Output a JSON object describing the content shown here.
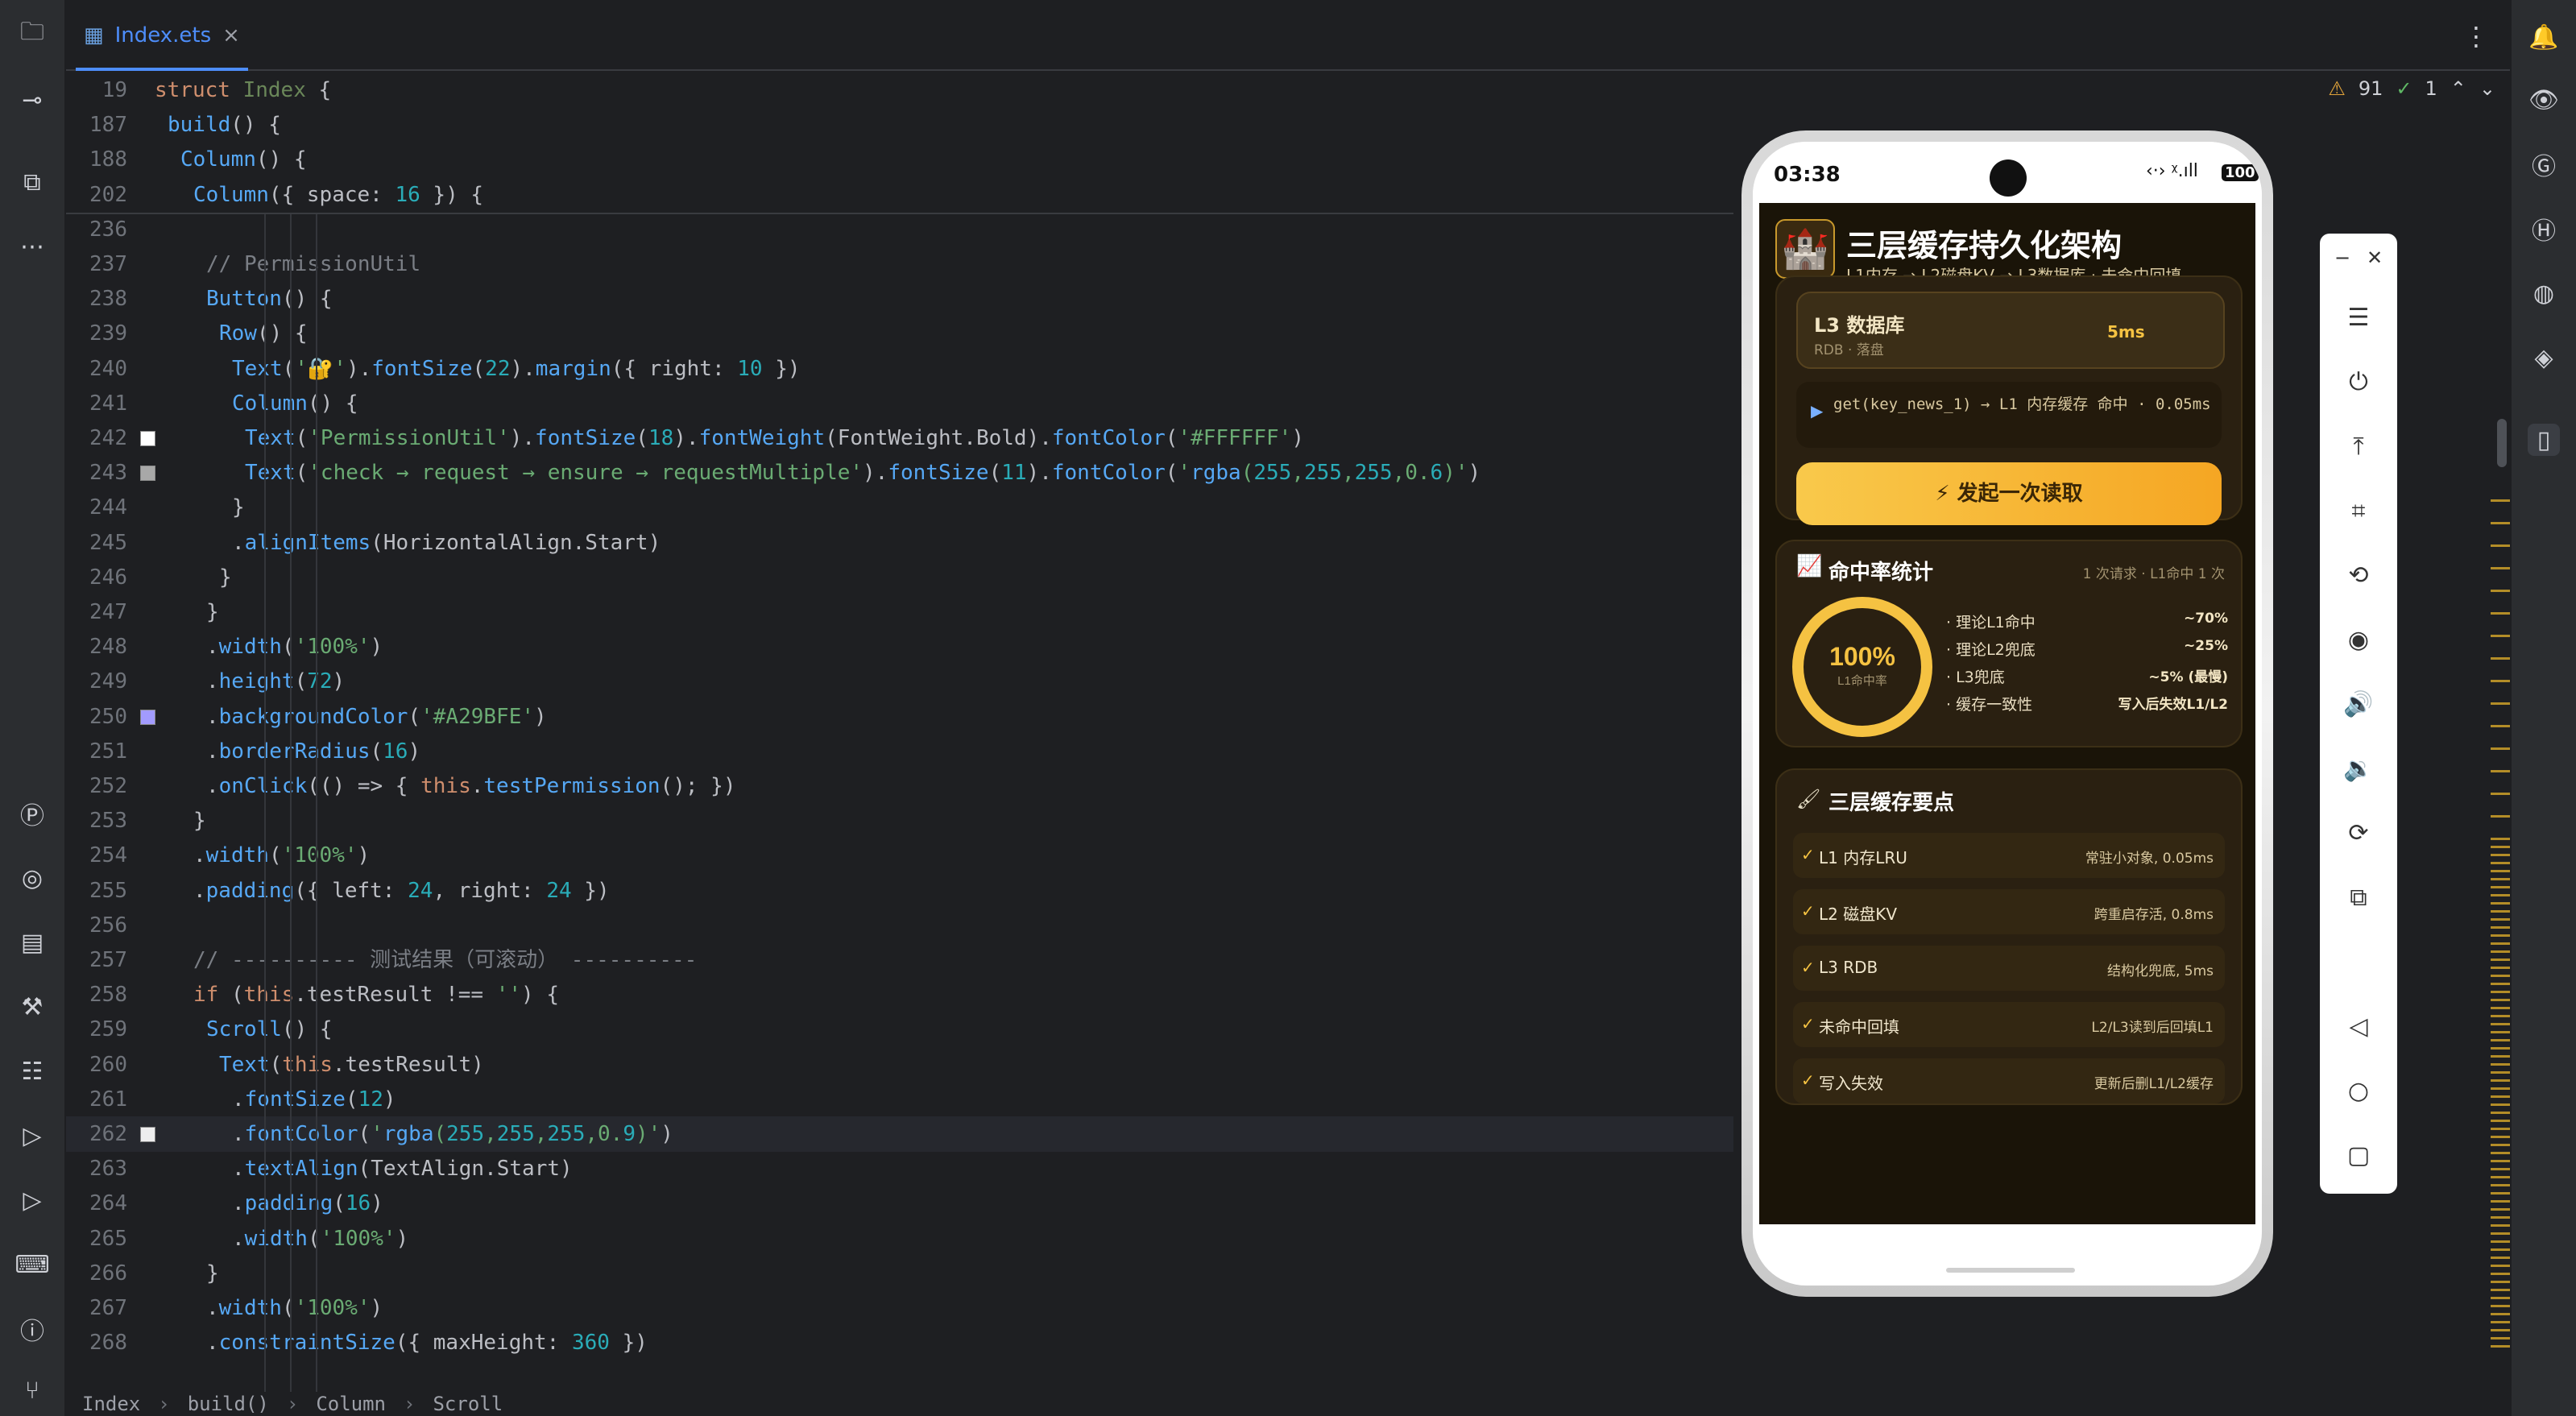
{
  "tab": {
    "filename": "Index.ets",
    "close": "×",
    "more": "⋮"
  },
  "inspect": {
    "warn_icon": "⚠",
    "warnings": "91",
    "ok_icon": "✓",
    "ok_count": "1",
    "up": "⌃",
    "down": "⌄"
  },
  "lines": [
    {
      "n": "19",
      "t": "struct Index {"
    },
    {
      "n": "187",
      "t": "build() {"
    },
    {
      "n": "188",
      "t": "Column() {"
    },
    {
      "n": "202",
      "t": "Column({ space: 16 }) {"
    },
    {
      "n": "236",
      "t": ""
    },
    {
      "n": "237",
      "t": "// PermissionUtil"
    },
    {
      "n": "238",
      "t": "Button() {"
    },
    {
      "n": "239",
      "t": "Row() {"
    },
    {
      "n": "240",
      "t": "Text('🔐').fontSize(22).margin({ right: 10 })"
    },
    {
      "n": "241",
      "t": "Column() {"
    },
    {
      "n": "242",
      "t": "Text('PermissionUtil').fontSize(18).fontWeight(FontWeight.Bold).fontColor('#FFFFFF')"
    },
    {
      "n": "243",
      "t": "Text('check → request → ensure → requestMultiple').fontSize(11).fontColor('rgba(255,255,255,0.6)')"
    },
    {
      "n": "244",
      "t": "}"
    },
    {
      "n": "245",
      "t": ".alignItems(HorizontalAlign.Start)"
    },
    {
      "n": "246",
      "t": "}"
    },
    {
      "n": "247",
      "t": "}"
    },
    {
      "n": "248",
      "t": ".width('100%')"
    },
    {
      "n": "249",
      "t": ".height(72)"
    },
    {
      "n": "250",
      "t": ".backgroundColor('#A29BFE')"
    },
    {
      "n": "251",
      "t": ".borderRadius(16)"
    },
    {
      "n": "252",
      "t": ".onClick(() => { this.testPermission(); })"
    },
    {
      "n": "253",
      "t": "}"
    },
    {
      "n": "254",
      "t": ".width('100%')"
    },
    {
      "n": "255",
      "t": ".padding({ left: 24, right: 24 })"
    },
    {
      "n": "256",
      "t": ""
    },
    {
      "n": "257",
      "t": "// ---------- 测试结果（可滚动） ----------"
    },
    {
      "n": "258",
      "t": "if (this.testResult !== '') {"
    },
    {
      "n": "259",
      "t": "Scroll() {"
    },
    {
      "n": "260",
      "t": "Text(this.testResult)"
    },
    {
      "n": "261",
      "t": ".fontSize(12)"
    },
    {
      "n": "262",
      "t": ".fontColor('rgba(255,255,255,0.9)')"
    },
    {
      "n": "263",
      "t": ".textAlign(TextAlign.Start)"
    },
    {
      "n": "264",
      "t": ".padding(16)"
    },
    {
      "n": "265",
      "t": ".width('100%')"
    },
    {
      "n": "266",
      "t": "}"
    },
    {
      "n": "267",
      "t": ".width('100%')"
    },
    {
      "n": "268",
      "t": ".constraintSize({ maxHeight: 360 })"
    }
  ],
  "swatches": {
    "l242": "#FFFFFF",
    "l243": "#A8A8A8",
    "l250": "#A29BFE",
    "l262": "#EEEEEE"
  },
  "breadcrumb": [
    "Index",
    "build()",
    "Column",
    "Scroll"
  ],
  "phone": {
    "time": "03:38",
    "status_right": "‹·›  ᵡ.ıll",
    "battery": "100",
    "app_title": "三层缓存持久化架构",
    "app_subtitle": "L1内存 → L2磁盘KV → L3数据库 · 未命中回填",
    "app_icon": "🏰",
    "l3_title": "L3 数据库",
    "l3_sub": "RDB · 落盘",
    "l3_latency": "5ms",
    "log_icon": "▶",
    "log_text": "get(key_news_1) → L1 内存缓存 命中 · 0.05ms",
    "read_button": "⚡ 发起一次读取",
    "stats_icon": "📈",
    "stats_title": "命中率统计",
    "stats_meta": "1 次请求 · L1命中 1 次",
    "ring_value": 1.0,
    "ring_label": "100%",
    "ring_sub": "L1命中率",
    "stats_rows": [
      {
        "k": "理论L1命中",
        "v": "~70%"
      },
      {
        "k": "理论L2兜底",
        "v": "~25%"
      },
      {
        "k": "L3兜底",
        "v": "~5% (最慢)"
      },
      {
        "k": "缓存一致性",
        "v": "写入后失效L1/L2"
      }
    ],
    "points_icon": "🖌",
    "points_title": "三层缓存要点",
    "points": [
      {
        "k": "L1 内存LRU",
        "v": "常驻小对象, 0.05ms"
      },
      {
        "k": "L2 磁盘KV",
        "v": "跨重启存活, 0.8ms"
      },
      {
        "k": "L3 RDB",
        "v": "结构化兜底, 5ms"
      },
      {
        "k": "未命中回填",
        "v": "L2/L3读到后回填L1"
      },
      {
        "k": "写入失效",
        "v": "更新后删L1/L2缓存"
      }
    ],
    "check": "✓"
  },
  "emu": {
    "minimize": "−",
    "close": "✕"
  },
  "colors": {
    "accent": "#4d8dfa",
    "gold": "#f5c242",
    "editor_bg": "#1e1f22"
  }
}
